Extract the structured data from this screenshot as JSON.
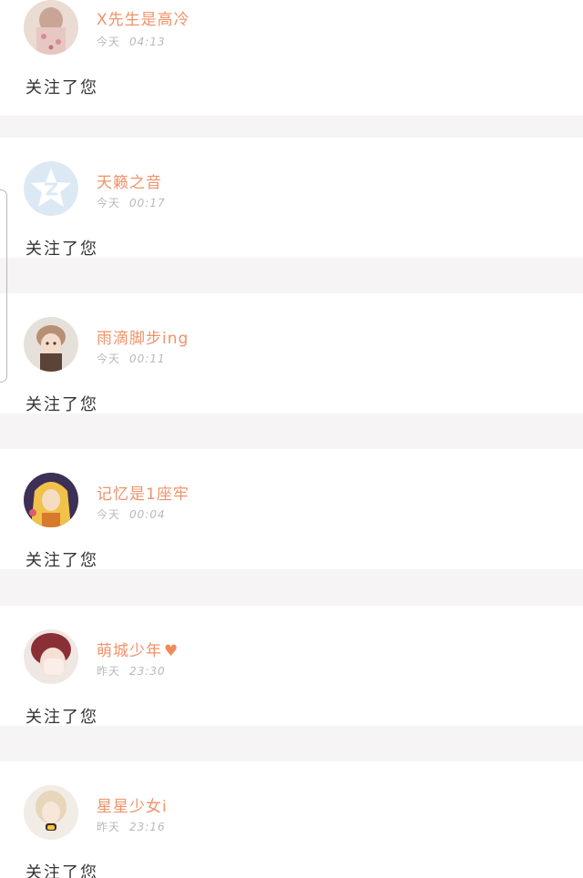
{
  "notifications": [
    {
      "name": "X先生是高冷",
      "day": "今天",
      "time": "04:13",
      "action": "关注了您",
      "heart": ""
    },
    {
      "name": "天籁之音",
      "day": "今天",
      "time": "00:17",
      "action": "关注了您",
      "heart": ""
    },
    {
      "name": "雨滴脚步ing",
      "day": "今天",
      "time": "00:11",
      "action": "关注了您",
      "heart": ""
    },
    {
      "name": "记忆是1座牢",
      "day": "今天",
      "time": "00:04",
      "action": "关注了您",
      "heart": ""
    },
    {
      "name": "萌城少年",
      "day": "昨天",
      "time": "23:30",
      "action": "关注了您",
      "heart": "♥"
    },
    {
      "name": "星星少女i",
      "day": "昨天",
      "time": "23:16",
      "action": "关注了您",
      "heart": ""
    }
  ],
  "colors": {
    "name": "#f0926a",
    "time": "#b9b9b9",
    "action": "#333333",
    "separator": "#f6f4f5",
    "avatar_placeholder": "#dde8f5"
  }
}
